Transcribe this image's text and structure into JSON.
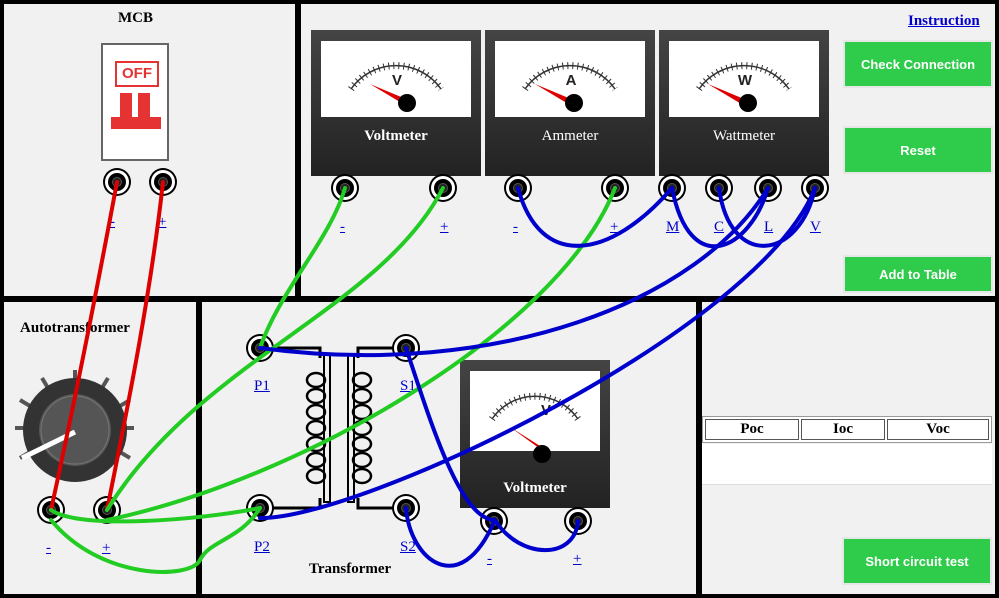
{
  "mcb": {
    "title": "MCB",
    "switch_text": "OFF",
    "terminals": [
      "-",
      "+"
    ]
  },
  "controls": {
    "instruction": "Instruction",
    "check_connection": "Check Connection",
    "reset": "Reset",
    "add_to_table": "Add to Table",
    "short_circuit_test": "Short circuit test"
  },
  "meters": {
    "voltmeter": {
      "symbol": "V",
      "label": "Voltmeter",
      "terminals": [
        "-",
        "+"
      ]
    },
    "ammeter": {
      "symbol": "A",
      "label": "Ammeter",
      "terminals": [
        "-",
        "+"
      ]
    },
    "wattmeter": {
      "symbol": "W",
      "label": "Wattmeter",
      "terminals": [
        "M",
        "C",
        "L",
        "V"
      ]
    },
    "voltmeter2": {
      "symbol": "V",
      "label": "Voltmeter",
      "terminals": [
        "-",
        "+"
      ]
    }
  },
  "autotransformer": {
    "title": "Autotransformer",
    "terminals": [
      "-",
      "+"
    ]
  },
  "transformer": {
    "title": "Transformer",
    "terminals": {
      "p1": "P1",
      "p2": "P2",
      "s1": "S1",
      "s2": "S2"
    }
  },
  "table": {
    "headers": [
      "Poc",
      "Ioc",
      "Voc"
    ],
    "rows": []
  },
  "colors": {
    "button": "#2ecc4a",
    "wire_red": "#dd0000",
    "wire_green": "#22cc22",
    "wire_blue": "#0000cc",
    "needle": "#dd0000"
  }
}
